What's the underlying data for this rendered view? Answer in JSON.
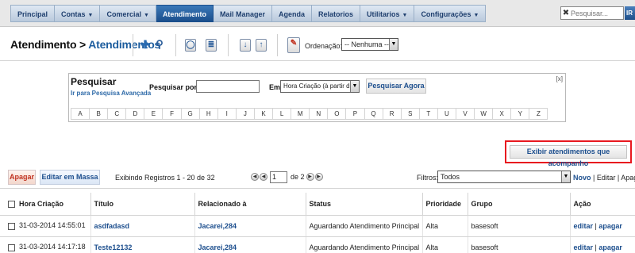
{
  "nav": {
    "tabs": [
      {
        "label": "Principal",
        "caret": ""
      },
      {
        "label": "Contas",
        "caret": "▼"
      },
      {
        "label": "Comercial",
        "caret": "▼"
      },
      {
        "label": "Atendimento",
        "caret": ""
      },
      {
        "label": "Mail Manager",
        "caret": ""
      },
      {
        "label": "Agenda",
        "caret": ""
      },
      {
        "label": "Relatorios",
        "caret": ""
      },
      {
        "label": "Utilitarios",
        "caret": "▼"
      },
      {
        "label": "Configurações",
        "caret": "▼"
      }
    ],
    "active_tab": "Atendimento",
    "search_placeholder": "Pesquisar...",
    "search_button": "IR"
  },
  "header": {
    "title_prefix": "Atendimento >",
    "title_link": "Atendimentos",
    "ordenacao_label": "Ordenação:",
    "ordenacao_value": "-- Nenhuma --"
  },
  "search_panel": {
    "title": "Pesquisar",
    "advanced_link": "Ir para Pesquisa Avançada",
    "search_by_label": "Pesquisar por",
    "em_label": "Em",
    "field_value": "Hora Criação (à partir de)",
    "submit_label": "Pesquisar Agora",
    "close_label": "[x]",
    "letters": [
      "A",
      "B",
      "C",
      "D",
      "E",
      "F",
      "G",
      "H",
      "I",
      "J",
      "K",
      "L",
      "M",
      "N",
      "O",
      "P",
      "Q",
      "R",
      "S",
      "T",
      "U",
      "V",
      "W",
      "X",
      "Y",
      "Z"
    ]
  },
  "follow_button": "Exibir atendimentos que acompanho",
  "list_toolbar": {
    "delete_label": "Apagar",
    "mass_edit_label": "Editar em Massa",
    "records_text": "Exibindo Registros 1 - 20 de 32",
    "page_value": "1",
    "page_of": "de 2",
    "filter_label": "Filtros:",
    "filter_value": "Todos",
    "filter_new": "Novo",
    "filter_links": " | Editar | Apagar"
  },
  "table": {
    "columns": [
      "Hora Criação",
      "Título",
      "Relacionado à",
      "Status",
      "Prioridade",
      "Grupo",
      "Ação"
    ],
    "rows": [
      {
        "hora": "31-03-2014 14:55:01",
        "titulo": "asdfadasd",
        "relacionado": "Jacarei,284",
        "status": "Aguardando Atendimento Principal",
        "prioridade": "Alta",
        "grupo": "basesoft",
        "editar": "editar",
        "sep": " | ",
        "apagar": "apagar"
      },
      {
        "hora": "31-03-2014 14:17:18",
        "titulo": "Teste12132",
        "relacionado": "Jacarei,284",
        "status": "Aguardando Atendimento Principal",
        "prioridade": "Alta",
        "grupo": "basesoft",
        "editar": "editar",
        "sep": " | ",
        "apagar": "apagar"
      }
    ]
  }
}
